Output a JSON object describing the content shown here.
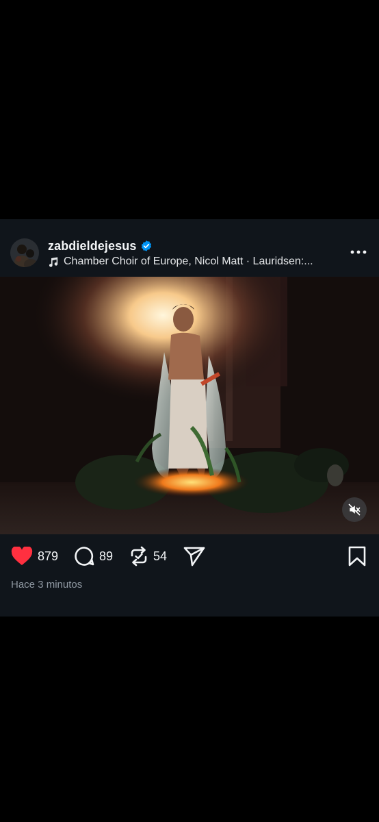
{
  "post": {
    "username": "zabdieldejesus",
    "verified": true,
    "music_text": "Chamber Choir of Europe, Nicol Matt · Lauridsen:...",
    "likes": "879",
    "comments": "89",
    "reposts": "54",
    "timestamp": "Hace 3 minutos",
    "liked": true
  },
  "icons": {
    "avatar": "avatar",
    "verified": "verified-badge-icon",
    "music": "music-note-icon",
    "more": "more-dots-icon",
    "mute": "muted-speaker-icon",
    "like": "heart-icon",
    "comment": "comment-bubble-icon",
    "repost": "repost-icon",
    "share": "send-icon",
    "bookmark": "bookmark-icon"
  },
  "colors": {
    "background": "#000000",
    "post_background": "#10151b",
    "text_primary": "#f3f5f7",
    "text_secondary": "#9099a3",
    "like_red": "#ff3040",
    "verified_blue": "#0095f6"
  }
}
